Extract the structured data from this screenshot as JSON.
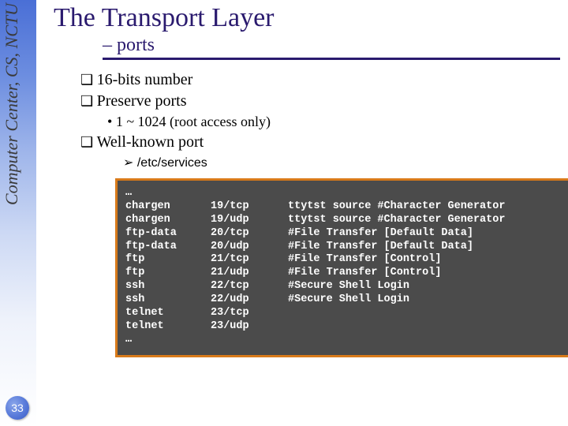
{
  "sidebar": {
    "affiliation": "Computer Center, CS, NCTU",
    "slide_number": "33"
  },
  "title": "The Transport Layer",
  "subtitle": "– ports",
  "bullets": {
    "b1": "16-bits number",
    "b2": "Preserve ports",
    "b2_sub1": "1 ~ 1024 (root access only)",
    "b3": "Well-known port",
    "b3_sub1": "/etc/services"
  },
  "services": {
    "ellipsis_top": "…",
    "ellipsis_bottom": "…",
    "rows": [
      {
        "svc": "chargen",
        "port": "19/tcp",
        "rest": "  ttytst source        #Character Generator"
      },
      {
        "svc": "chargen",
        "port": "19/udp",
        "rest": "  ttytst source        #Character Generator"
      },
      {
        "svc": "ftp-data",
        "port": "20/tcp",
        "rest": "#File Transfer [Default Data]"
      },
      {
        "svc": "ftp-data",
        "port": "20/udp",
        "rest": "#File Transfer [Default Data]"
      },
      {
        "svc": "ftp",
        "port": "21/tcp",
        "rest": "#File Transfer [Control]"
      },
      {
        "svc": "ftp",
        "port": "21/udp",
        "rest": "#File Transfer [Control]"
      },
      {
        "svc": "ssh",
        "port": "22/tcp",
        "rest": "#Secure Shell Login"
      },
      {
        "svc": "ssh",
        "port": "22/udp",
        "rest": "#Secure Shell Login"
      },
      {
        "svc": "telnet",
        "port": "23/tcp",
        "rest": ""
      },
      {
        "svc": "telnet",
        "port": "23/udp",
        "rest": ""
      }
    ]
  }
}
